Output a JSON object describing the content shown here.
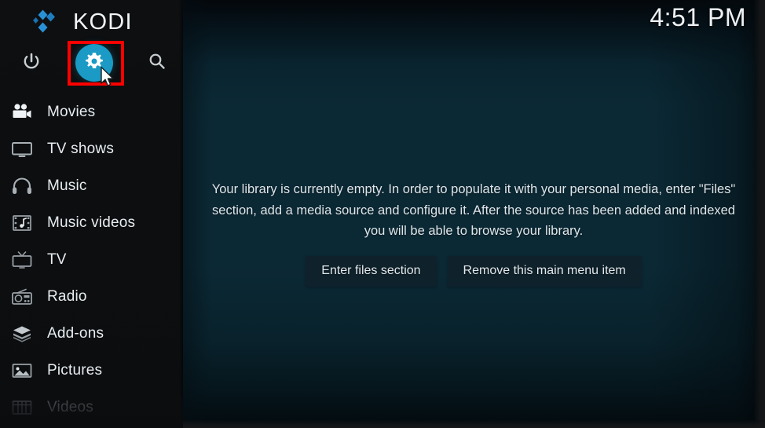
{
  "app": {
    "name": "KODI",
    "logo_icon": "kodi-logo-icon",
    "logo_color": "#2a90d6"
  },
  "header": {
    "clock": "4:51 PM",
    "power_icon": "power-icon",
    "settings_icon": "gear-icon",
    "search_icon": "search-icon",
    "settings_accent_color": "#1a9ac4",
    "annotation_color": "#fe0000"
  },
  "sidebar": {
    "items": [
      {
        "label": "Movies",
        "icon": "movie-camera-icon",
        "dim": false
      },
      {
        "label": "TV shows",
        "icon": "television-icon",
        "dim": false
      },
      {
        "label": "Music",
        "icon": "headphones-icon",
        "dim": false
      },
      {
        "label": "Music videos",
        "icon": "music-film-icon",
        "dim": false
      },
      {
        "label": "TV",
        "icon": "tv-antenna-icon",
        "dim": false
      },
      {
        "label": "Radio",
        "icon": "radio-icon",
        "dim": false
      },
      {
        "label": "Add-ons",
        "icon": "package-box-icon",
        "dim": false
      },
      {
        "label": "Pictures",
        "icon": "picture-icon",
        "dim": false
      },
      {
        "label": "Videos",
        "icon": "film-strip-icon",
        "dim": true
      }
    ]
  },
  "main": {
    "empty_message": "Your library is currently empty. In order to populate it with your personal media, enter \"Files\" section, add a media source and configure it. After the source has been added and indexed you will be able to browse your library.",
    "buttons": [
      {
        "label": "Enter files section"
      },
      {
        "label": "Remove this main menu item"
      }
    ]
  }
}
